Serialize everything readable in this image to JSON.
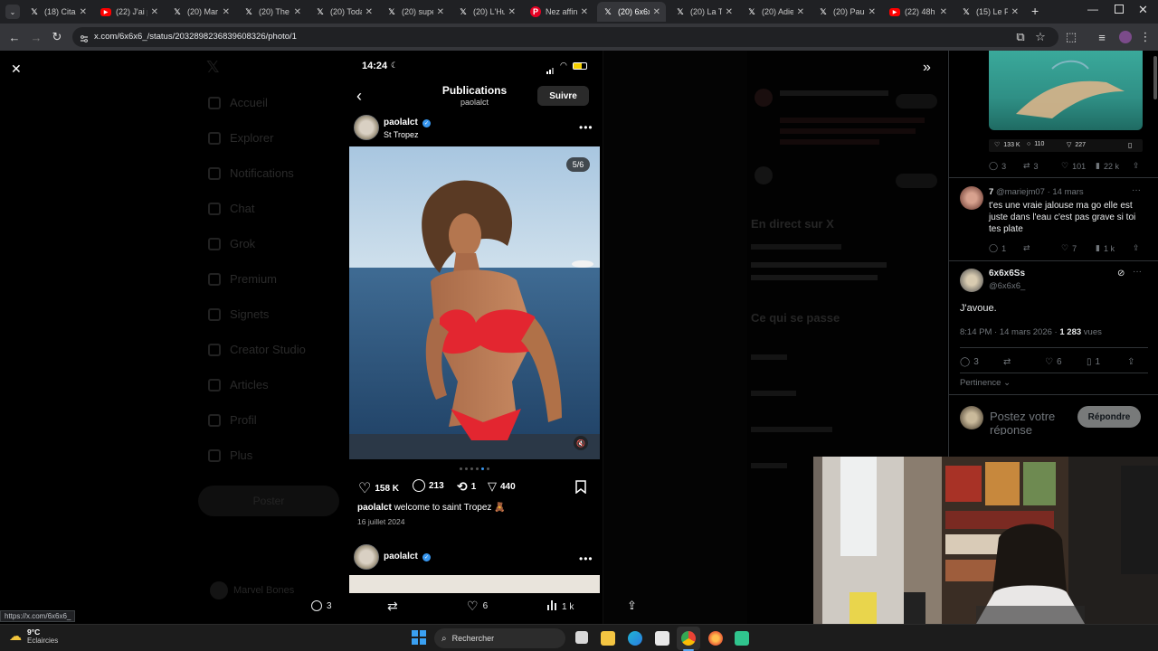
{
  "browser": {
    "tabs": [
      {
        "title": "(18) Cita",
        "icon": "x-icon"
      },
      {
        "title": "(22) J'ai p",
        "icon": "youtube-icon"
      },
      {
        "title": "(20) Mar",
        "icon": "x-icon"
      },
      {
        "title": "(20) The",
        "icon": "x-icon"
      },
      {
        "title": "(20) Toda",
        "icon": "x-icon"
      },
      {
        "title": "(20) supe",
        "icon": "x-icon"
      },
      {
        "title": "(20) L'Hu",
        "icon": "x-icon"
      },
      {
        "title": "Nez affin",
        "icon": "pinterest-icon"
      },
      {
        "title": "(20) 6x6x",
        "icon": "x-icon",
        "active": true
      },
      {
        "title": "(20) La T",
        "icon": "x-icon"
      },
      {
        "title": "(20) Adie",
        "icon": "x-icon"
      },
      {
        "title": "(20) Paul",
        "icon": "x-icon"
      },
      {
        "title": "(22) 48h",
        "icon": "youtube-icon"
      },
      {
        "title": "(15) Le F",
        "icon": "x-icon"
      }
    ],
    "url": "x.com/6x6x6_/status/2032898236839608326/photo/1",
    "status_url": "https://x.com/6x6x6_"
  },
  "sidebar_nav": [
    "Accueil",
    "Explorer",
    "Notifications",
    "Chat",
    "Grok",
    "Premium",
    "Signets",
    "Creator Studio",
    "Articles",
    "Profil",
    "Plus"
  ],
  "sidebar_post_button": "Poster",
  "sidebar_user": "Marvel Bones",
  "phone": {
    "time": "14:24",
    "header_title": "Publications",
    "header_subtitle": "paolalct",
    "follow_label": "Suivre",
    "username": "paolalct",
    "location": "St Tropez",
    "counter": "5/6",
    "likes": "158 K",
    "comments": "213",
    "reposts": "1",
    "shares": "440",
    "caption_user": "paolalct",
    "caption_text": "welcome to saint Tropez 🧸",
    "date": "16 juillet 2024",
    "next_username": "paolalct"
  },
  "tweet_actions": {
    "replies": "3",
    "likes": "6",
    "views": "1 k"
  },
  "right": {
    "thumb_stats": {
      "likes": "133 K",
      "comments": "110",
      "shares": "227"
    },
    "thumb_actions": {
      "replies": "3",
      "reposts": "3",
      "likes": "101",
      "views": "22 k"
    },
    "reply": {
      "name": "7",
      "handle": "@mariejm07 · 14 mars",
      "text": "t'es une vraie jalouse ma go elle est juste dans l'eau c'est pas grave si toi tes plate",
      "replies": "1",
      "likes": "7",
      "views": "1 k"
    },
    "author": {
      "name": "6x6x6Ss",
      "handle": "@6x6x6_",
      "text": "J'avoue.",
      "meta": "8:14 PM · 14 mars 2026 ·",
      "views_count": "1 283",
      "views_label": "vues",
      "replies": "3",
      "likes": "6",
      "bookmarks": "1"
    },
    "sort_label": "Pertinence",
    "reply_placeholder": "Postez votre réponse",
    "reply_button": "Répondre"
  },
  "background_right": {
    "live_heading": "En direct sur X",
    "happening_heading": "Ce qui se passe"
  },
  "taskbar": {
    "weather_temp": "9°C",
    "weather_desc": "Eclaircies",
    "search_label": "Rechercher"
  }
}
